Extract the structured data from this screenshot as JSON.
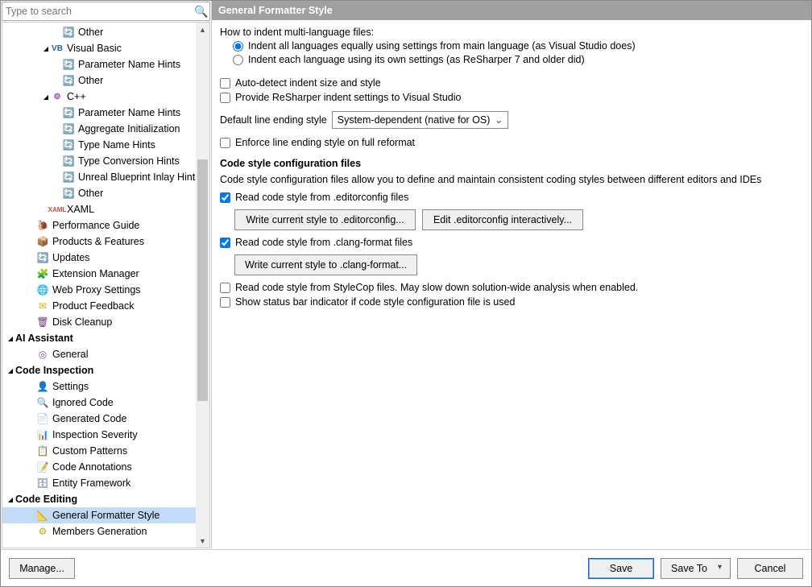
{
  "search": {
    "placeholder": "Type to search"
  },
  "tree": {
    "other1": "Other",
    "vb": "Visual Basic",
    "vb_param": "Parameter Name Hints",
    "vb_other": "Other",
    "cpp": "C++",
    "cpp_param": "Parameter Name Hints",
    "cpp_agg": "Aggregate Initialization",
    "cpp_type": "Type Name Hints",
    "cpp_conv": "Type Conversion Hints",
    "cpp_unreal": "Unreal Blueprint Inlay Hints",
    "cpp_other": "Other",
    "xaml": "XAML",
    "perf": "Performance Guide",
    "prodfeat": "Products & Features",
    "updates": "Updates",
    "extmgr": "Extension Manager",
    "proxy": "Web Proxy Settings",
    "feedback": "Product Feedback",
    "disk": "Disk Cleanup",
    "aia": "AI Assistant",
    "aia_general": "General",
    "ci": "Code Inspection",
    "ci_settings": "Settings",
    "ci_ignored": "Ignored Code",
    "ci_gen": "Generated Code",
    "ci_sev": "Inspection Severity",
    "ci_pat": "Custom Patterns",
    "ci_ann": "Code Annotations",
    "ci_ef": "Entity Framework",
    "ce": "Code Editing",
    "ce_fmt": "General Formatter Style",
    "ce_mem": "Members Generation"
  },
  "content": {
    "title": "General Formatter Style",
    "indent_q": "How to indent multi-language files:",
    "radio_all": "Indent all languages equally using settings from main language (as Visual Studio does)",
    "radio_each": "Indent each language using its own settings (as ReSharper 7 and older did)",
    "auto_detect": "Auto-detect indent size and style",
    "provide_vs": "Provide ReSharper indent settings to Visual Studio",
    "line_ending_label": "Default line ending style",
    "line_ending_value": "System-dependent (native for OS)",
    "enforce_line": "Enforce line ending style on full reformat",
    "config_heading": "Code style configuration files",
    "config_desc": "Code style configuration files allow you to define and maintain consistent coding styles between different editors and IDEs",
    "read_editorconfig": "Read code style from .editorconfig files",
    "btn_write_editorconfig": "Write current style to .editorconfig...",
    "btn_edit_editorconfig": "Edit .editorconfig interactively...",
    "read_clang": "Read code style from .clang-format files",
    "btn_write_clang": "Write current style to .clang-format...",
    "read_stylecop": "Read code style from StyleCop files. May slow down solution-wide analysis when enabled.",
    "status_indicator": "Show status bar indicator if code style configuration file is used"
  },
  "buttons": {
    "manage": "Manage...",
    "save": "Save",
    "save_to": "Save To",
    "cancel": "Cancel"
  }
}
